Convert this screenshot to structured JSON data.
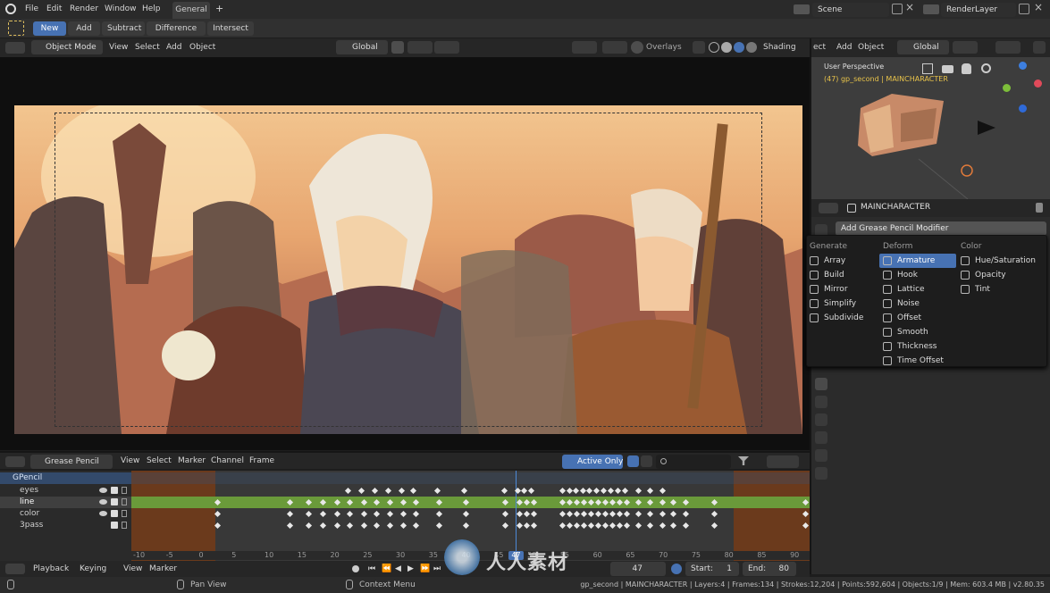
{
  "topbar": {
    "menus": [
      "File",
      "Edit",
      "Render",
      "Window",
      "Help"
    ],
    "workspace_tab": "General",
    "add_tab": "+",
    "scene": "Scene",
    "render_layer": "RenderLayer"
  },
  "toolbar2": {
    "modes": [
      "New",
      "Add",
      "Subtract",
      "Difference",
      "Intersect"
    ]
  },
  "viewport_header": {
    "mode": "Object Mode",
    "menus": [
      "View",
      "Select",
      "Add",
      "Object"
    ],
    "orientation": "Global",
    "overlays": "Overlays",
    "shading": "Shading"
  },
  "mini_view": {
    "menus": [
      "ect",
      "Add",
      "Object"
    ],
    "orientation": "Global",
    "title": "User Perspective",
    "subtitle": "(47) gp_second | MAINCHARACTER"
  },
  "properties": {
    "object": "MAINCHARACTER",
    "modifier_button": "Add Grease Pencil Modifier"
  },
  "modifiers": {
    "generate": {
      "title": "Generate",
      "items": [
        "Array",
        "Build",
        "Mirror",
        "Simplify",
        "Subdivide"
      ]
    },
    "deform": {
      "title": "Deform",
      "items": [
        "Armature",
        "Hook",
        "Lattice",
        "Noise",
        "Offset",
        "Smooth",
        "Thickness",
        "Time Offset"
      ]
    },
    "color": {
      "title": "Color",
      "items": [
        "Hue/Saturation",
        "Opacity",
        "Tint"
      ]
    }
  },
  "dopesheet": {
    "editor": "Grease Pencil",
    "menus": [
      "View",
      "Select",
      "Marker",
      "Channel",
      "Frame"
    ],
    "active_only": "Active Only"
  },
  "channels": [
    {
      "name": "GPencil"
    },
    {
      "name": "eyes"
    },
    {
      "name": "line"
    },
    {
      "name": "color"
    },
    {
      "name": "3pass"
    }
  ],
  "ruler_labels": [
    "-10",
    "-5",
    "0",
    "5",
    "10",
    "15",
    "20",
    "25",
    "30",
    "35",
    "40",
    "45",
    "50",
    "55",
    "60",
    "65",
    "70",
    "75",
    "80",
    "85",
    "90"
  ],
  "current_frame_label": "47",
  "playback": {
    "menus": [
      "Playback",
      "Keying",
      "View",
      "Marker"
    ],
    "frame": "47",
    "start_label": "Start:",
    "start": "1",
    "end_label": "End:",
    "end": "80"
  },
  "statusbar": {
    "left": "Pan View",
    "mid": "Context Menu",
    "right": "gp_second | MAINCHARACTER | Layers:4 | Frames:134 | Strokes:12,204 | Points:592,604 | Objects:1/9 | Mem: 603.4 MB | v2.80.35"
  },
  "watermark": "人人素材",
  "colors": {
    "accent": "#4772b3",
    "keyrow": "#6a9a3a"
  }
}
